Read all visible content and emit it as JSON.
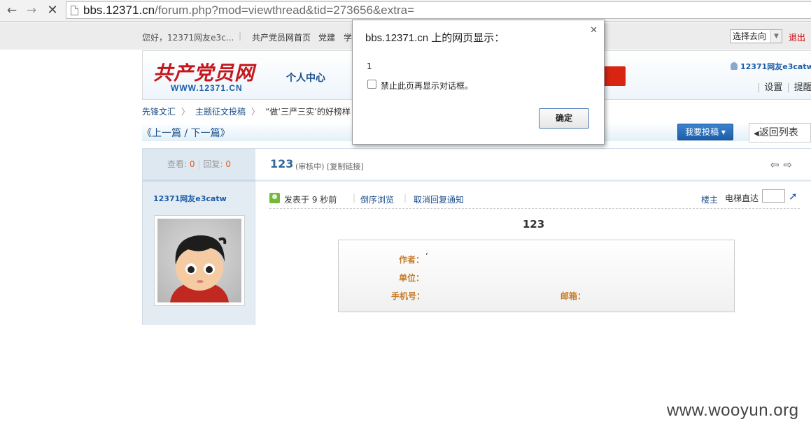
{
  "browser": {
    "url_host": "bbs.12371.cn",
    "url_rest": "/forum.php?mod=viewthread&tid=273656&extra="
  },
  "topbar": {
    "greeting": "您好，12371网友e3c...",
    "links": [
      "共产党员网首页",
      "党建",
      "学"
    ],
    "select_value": "选择去向",
    "logout": "退出"
  },
  "header": {
    "logo_title": "共产党员网",
    "logo_url": "WWW.12371.CN",
    "nav_personal": "个人中心",
    "username": "12371网友e3catw",
    "links": [
      "设置",
      "提醒"
    ]
  },
  "breadcrumb": [
    "先锋文汇",
    "主题征文投稿",
    "“做‘三严三实’的好榜样"
  ],
  "pager": {
    "prev_next": "《上一篇  /  下一篇》",
    "post_button": "我要投稿",
    "back_list": "返回列表"
  },
  "thread": {
    "views_label": "查看:",
    "views": "0",
    "replies_label": "回复:",
    "replies": "0",
    "title": "123",
    "meta": "(审核中) [复制链接]",
    "author": "12371网友e3catw",
    "posted": "发表于  9   秒前",
    "reverse": "倒序浏览",
    "cancel_notify": "取消回复通知",
    "owner": "楼主",
    "elevator": "电梯直达",
    "subject": "123",
    "fields": {
      "author_label": "作者：",
      "author_value": "’",
      "unit_label": "单位：",
      "phone_label": "手机号：",
      "email_label": "邮箱："
    }
  },
  "dialog": {
    "title": "bbs.12371.cn 上的网页显示：",
    "message": "1",
    "checkbox_label": "禁止此页再显示对话框。",
    "ok": "确定"
  },
  "watermark": "www.wooyun.org"
}
